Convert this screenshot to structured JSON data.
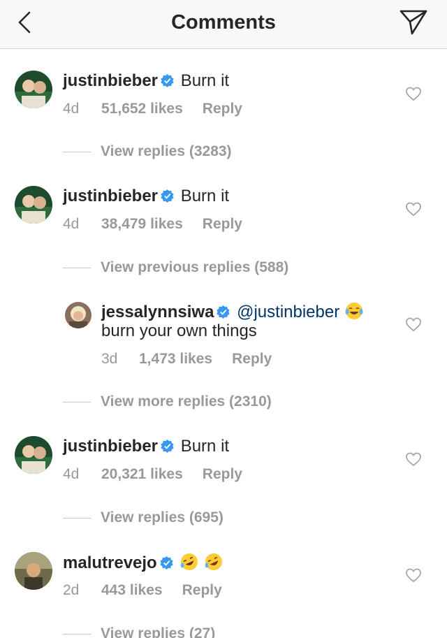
{
  "header": {
    "title": "Comments",
    "back_icon": "chevron-left-icon",
    "send_icon": "paper-plane-icon"
  },
  "comments": [
    {
      "user": "justinbieber",
      "text": "Burn it",
      "age": "4d",
      "likes": "51,652 likes",
      "reply": "Reply",
      "view_replies": "View replies (3283)"
    },
    {
      "user": "justinbieber",
      "text": "Burn it",
      "age": "4d",
      "likes": "38,479 likes",
      "reply": "Reply",
      "view_replies": "View previous replies (588)"
    },
    {
      "user": "justinbieber",
      "text": "Burn it",
      "age": "4d",
      "likes": "20,321 likes",
      "reply": "Reply",
      "view_replies": "View replies (695)"
    },
    {
      "user": "malutrevejo",
      "text": "",
      "age": "2d",
      "likes": "443 likes",
      "reply": "Reply",
      "view_replies": "View replies (27)"
    }
  ],
  "nested_reply": {
    "user": "jessalynnsiwa",
    "mention": "@justinbieber",
    "text": "burn your own things",
    "age": "3d",
    "likes": "1,473 likes",
    "reply": "Reply",
    "view_more": "View more replies (2310)"
  },
  "colors": {
    "verified": "#3897f0",
    "meta": "#999999",
    "text": "#262626"
  }
}
